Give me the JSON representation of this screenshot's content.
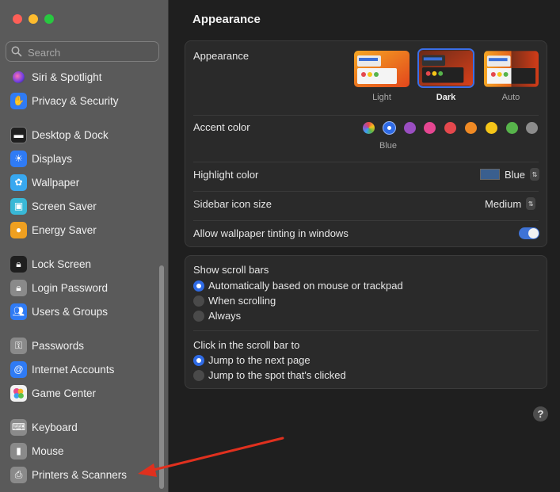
{
  "window": {
    "traffic_lights": [
      "#fe5f57",
      "#febc2e",
      "#28c840"
    ]
  },
  "sidebar": {
    "search_placeholder": "Search",
    "items": [
      {
        "label": "Siri & Spotlight",
        "icon": "siri-icon",
        "color": "#7c4dd8"
      },
      {
        "label": "Privacy & Security",
        "icon": "hand-icon",
        "color": "#2f7bf5"
      },
      {
        "label": "Desktop & Dock",
        "icon": "dock-icon",
        "color": "#1f1f1f"
      },
      {
        "label": "Displays",
        "icon": "sun-icon",
        "color": "#2f7bf5"
      },
      {
        "label": "Wallpaper",
        "icon": "flower-icon",
        "color": "#38a8f0"
      },
      {
        "label": "Screen Saver",
        "icon": "screensaver-icon",
        "color": "#39b8d6"
      },
      {
        "label": "Energy Saver",
        "icon": "bulb-icon",
        "color": "#f0a020"
      },
      {
        "label": "Lock Screen",
        "icon": "lock-icon",
        "color": "#1f1f1f"
      },
      {
        "label": "Login Password",
        "icon": "lock-key-icon",
        "color": "#8a8a8a"
      },
      {
        "label": "Users & Groups",
        "icon": "users-icon",
        "color": "#2f7bf5"
      },
      {
        "label": "Passwords",
        "icon": "key-icon",
        "color": "#8a8a8a"
      },
      {
        "label": "Internet Accounts",
        "icon": "at-icon",
        "color": "#2f7bf5"
      },
      {
        "label": "Game Center",
        "icon": "game-center-icon",
        "color": "#f2f2f2"
      },
      {
        "label": "Keyboard",
        "icon": "keyboard-icon",
        "color": "#8a8a8a"
      },
      {
        "label": "Mouse",
        "icon": "mouse-icon",
        "color": "#8a8a8a"
      },
      {
        "label": "Printers & Scanners",
        "icon": "printer-icon",
        "color": "#8a8a8a"
      }
    ]
  },
  "main": {
    "title": "Appearance",
    "appearance": {
      "label": "Appearance",
      "options": [
        "Light",
        "Dark",
        "Auto"
      ],
      "selected": "Dark"
    },
    "accent": {
      "label": "Accent color",
      "selected_name": "Blue",
      "colors": [
        "multicolor",
        "#2f6be6",
        "#9a4ec1",
        "#e54691",
        "#e5484d",
        "#f08a24",
        "#f5c518",
        "#57b44b",
        "#8c8c8c"
      ]
    },
    "highlight": {
      "label": "Highlight color",
      "value": "Blue",
      "swatch": "#3a5f8f"
    },
    "sidebar_icon_size": {
      "label": "Sidebar icon size",
      "value": "Medium"
    },
    "wallpaper_tinting": {
      "label": "Allow wallpaper tinting in windows",
      "on": true
    },
    "scroll_bars": {
      "label": "Show scroll bars",
      "options": [
        "Automatically based on mouse or trackpad",
        "When scrolling",
        "Always"
      ],
      "selected": 0
    },
    "click_scroll": {
      "label": "Click in the scroll bar to",
      "options": [
        "Jump to the next page",
        "Jump to the spot that's clicked"
      ],
      "selected": 0
    },
    "help_label": "?"
  },
  "colors": {
    "annotation_arrow": "#e0301e",
    "accent": "#2f6be6"
  }
}
